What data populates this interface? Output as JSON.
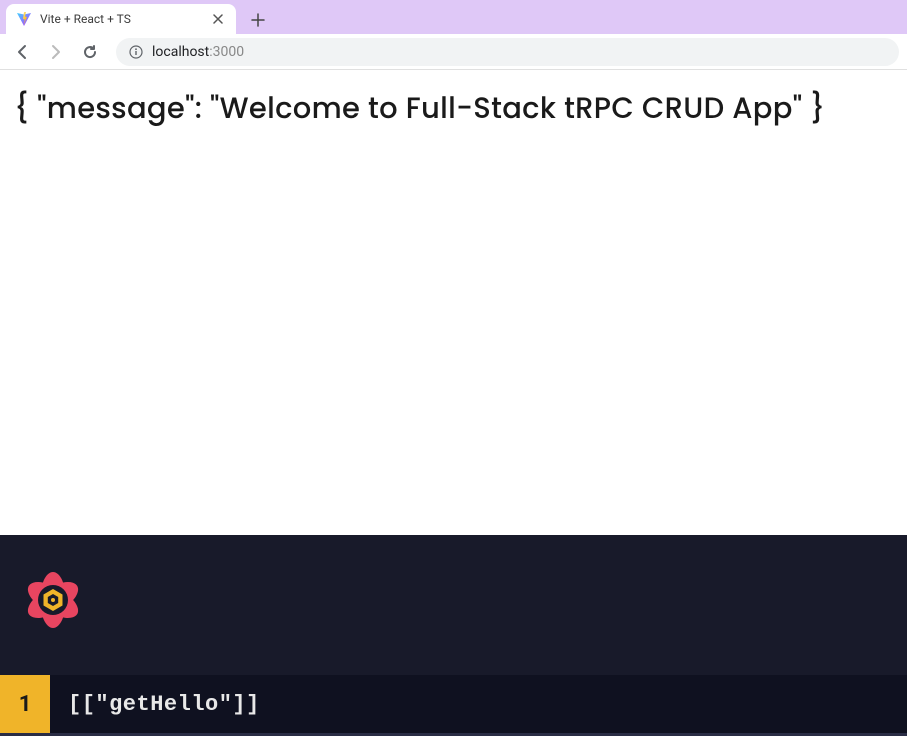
{
  "browser": {
    "tab": {
      "title": "Vite + React + TS"
    },
    "url": {
      "host": "localhost",
      "port": ":3000"
    }
  },
  "page": {
    "json_display": "{ \"message\": \"Welcome to Full-Stack tRPC CRUD App\" }"
  },
  "devtools": {
    "query_count": "1",
    "query_key": "[[\"getHello\"]]"
  }
}
